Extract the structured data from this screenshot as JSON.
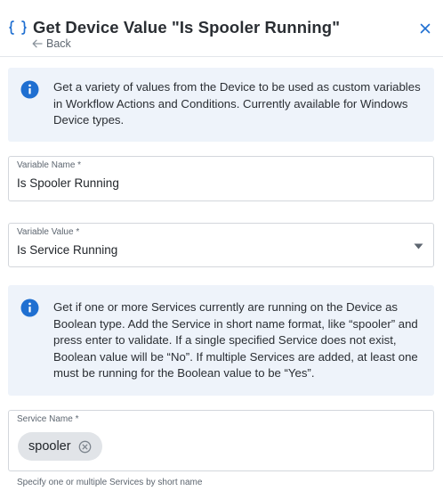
{
  "header": {
    "title": "Get Device Value \"Is Spooler Running\"",
    "back_label": "Back"
  },
  "info_top": {
    "text": "Get a variety of values from the Device to be used as custom variables in Workflow Actions and Conditions. Currently available for Windows Device types."
  },
  "variable_name": {
    "label": "Variable Name *",
    "value": "Is Spooler Running"
  },
  "variable_value": {
    "label": "Variable Value *",
    "value": "Is Service Running"
  },
  "info_service": {
    "text": "Get if one or more Services currently are running on the Device as Boolean type. Add the Service in short name format, like “spooler” and press enter to validate. If a single specified Service does not exist, Boolean value will be “No”. If multiple Services are added, at least one must be running for the Boolean value to be “Yes”."
  },
  "service_name": {
    "label": "Service Name *",
    "chips": [
      "spooler"
    ],
    "helper": "Specify one or multiple Services by short name"
  },
  "colors": {
    "accent": "#1f6fd1",
    "info_bg": "#eef3fa",
    "chip_bg": "#e1e4e8"
  },
  "icons": {
    "header": "curly-braces-icon",
    "back": "arrow-left-icon",
    "close": "close-icon",
    "info": "info-circle-icon",
    "dropdown": "caret-down-icon",
    "chip_remove": "remove-circle-icon"
  }
}
